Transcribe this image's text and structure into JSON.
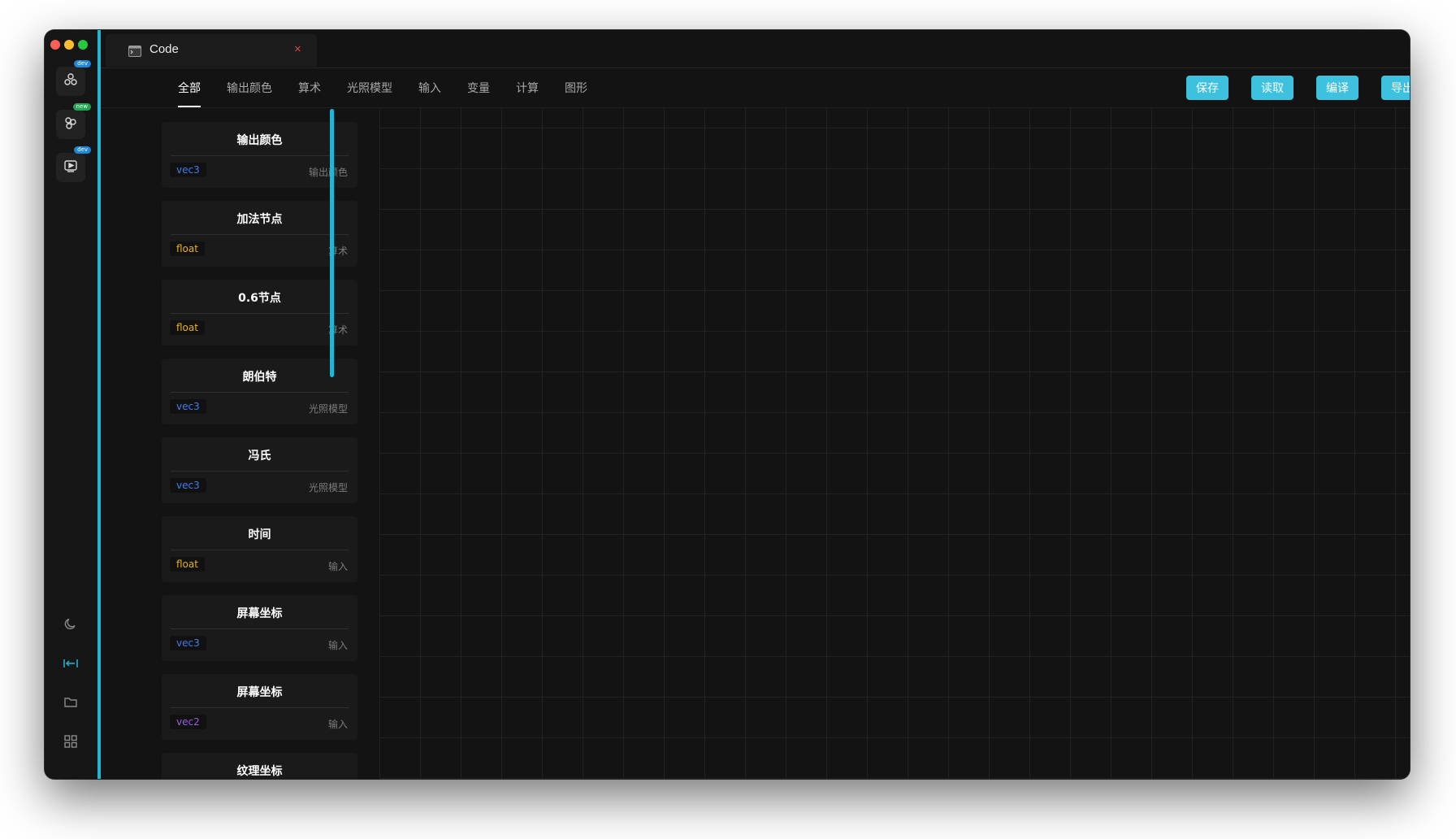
{
  "window": {
    "title": "Code",
    "close_symbol": "×"
  },
  "rail": {
    "top_items": [
      {
        "icon": "node-cluster-icon",
        "badge": "dev",
        "badge_color": "#1e88d6"
      },
      {
        "icon": "node-graph-icon",
        "badge": "new",
        "badge_color": "#22a652"
      },
      {
        "icon": "video-player-icon",
        "badge": "dev",
        "badge_color": "#1e88d6"
      }
    ],
    "bottom_items": [
      "moon-icon",
      "collapse-icon",
      "folder-icon",
      "grid-icon"
    ]
  },
  "categories": [
    "全部",
    "输出颜色",
    "算术",
    "光照模型",
    "输入",
    "变量",
    "计算",
    "图形"
  ],
  "active_category": "全部",
  "actions": [
    "保存",
    "读取",
    "编译",
    "导出"
  ],
  "nodes": [
    {
      "title": "输出颜色",
      "type": "vec3",
      "category": "输出颜色"
    },
    {
      "title": "加法节点",
      "type": "float",
      "category": "算术"
    },
    {
      "title": "0.6节点",
      "type": "float",
      "category": "算术"
    },
    {
      "title": "朗伯特",
      "type": "vec3",
      "category": "光照模型"
    },
    {
      "title": "冯氏",
      "type": "vec3",
      "category": "光照模型"
    },
    {
      "title": "时间",
      "type": "float",
      "category": "输入"
    },
    {
      "title": "屏幕坐标",
      "type": "vec3",
      "category": "输入"
    },
    {
      "title": "屏幕坐标",
      "type": "vec2",
      "category": "输入"
    },
    {
      "title": "纹理坐标",
      "type": "",
      "category": ""
    }
  ],
  "colors": {
    "accent": "#3ec0df",
    "type_vec3": "#3d7ef0",
    "type_vec2": "#9b5de5",
    "type_float": "#e8b21c",
    "close": "#e5463f"
  }
}
